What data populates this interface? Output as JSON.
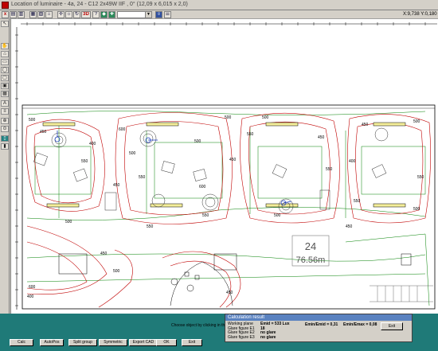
{
  "window": {
    "title": "Location of luminaire - 4a, 24 - C12 2x49W IIF , 0° (12,09 x 6,015 x 2,0)"
  },
  "status": {
    "coords": "X:9,738 Y:0,180"
  },
  "toolbar": {
    "buttons": [
      "x",
      "▤",
      "▥",
      "▦",
      "▧",
      "⌂",
      "✢",
      "☼",
      "↻",
      "3D",
      "?",
      "◆",
      "✚"
    ],
    "dropdown_value": ""
  },
  "left_tools": [
    "↖",
    "✋",
    "⌂",
    "▭",
    "◯",
    "▢",
    "▣",
    "▦",
    "A",
    "≡",
    "⊕",
    "⊙",
    "▯",
    "▮"
  ],
  "drawing": {
    "area_label": "24",
    "area_value": "76.56m",
    "contour_labels": [
      "500",
      "450",
      "400",
      "550",
      "600",
      "500",
      "450",
      "550",
      "500",
      "600",
      "500",
      "450",
      "550",
      "500",
      "450",
      "550",
      "400",
      "450",
      "500",
      "550",
      "500",
      "550",
      "450",
      "500",
      "400",
      "550",
      "500",
      "450",
      "600",
      "450",
      "550",
      "500"
    ]
  },
  "bottom": {
    "hint": "Choose object by clicking in the list",
    "buttons": [
      "Calc",
      "AutoPos",
      "Split group",
      "Symmetric",
      "Export CAD",
      "OK",
      "Exit"
    ]
  },
  "calc": {
    "title": "Calculation result",
    "labels": [
      "Working plane",
      "Glare figure E1",
      "Glare figure E2",
      "Glare figure E3"
    ],
    "values": [
      "Emid = 533 Lux",
      "18",
      "no glare",
      "no glare"
    ],
    "ratio1": "Emin/Emid = 0,31",
    "ratio2": "Emin/Emax = 0,08",
    "exit_label": "Exit"
  },
  "colors": {
    "panel": "#1f7a78",
    "calc_header": "#5a82c0",
    "contour_red": "#c00000",
    "contour_green": "#008000"
  }
}
